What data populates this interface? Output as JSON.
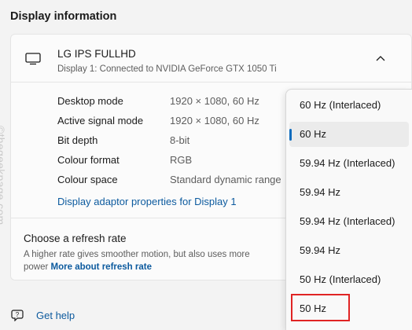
{
  "section_title": "Display information",
  "display": {
    "name": "LG IPS FULLHD",
    "subtitle": "Display 1: Connected to NVIDIA GeForce GTX 1050 Ti"
  },
  "info_rows": [
    {
      "label": "Desktop mode",
      "value": "1920 × 1080, 60 Hz"
    },
    {
      "label": "Active signal mode",
      "value": "1920 × 1080, 60 Hz"
    },
    {
      "label": "Bit depth",
      "value": "8-bit"
    },
    {
      "label": "Colour format",
      "value": "RGB"
    },
    {
      "label": "Colour space",
      "value": "Standard dynamic range"
    }
  ],
  "adapter_link": "Display adaptor properties for Display 1",
  "refresh": {
    "title": "Choose a refresh rate",
    "description": "A higher rate gives smoother motion, but also uses more power",
    "link": "More about refresh rate"
  },
  "help_label": "Get help",
  "dropdown": {
    "options": [
      "60 Hz (Interlaced)",
      "60 Hz",
      "59.94 Hz (Interlaced)",
      "59.94 Hz",
      "59.94 Hz (Interlaced)",
      "59.94 Hz",
      "50 Hz (Interlaced)",
      "50 Hz"
    ],
    "selected": "60 Hz",
    "highlighted": "50 Hz"
  },
  "watermark": "©thegeekpage.com",
  "colors": {
    "accent": "#0f6cbd",
    "link": "#0c5a9e",
    "highlight_box": "#e02424"
  }
}
